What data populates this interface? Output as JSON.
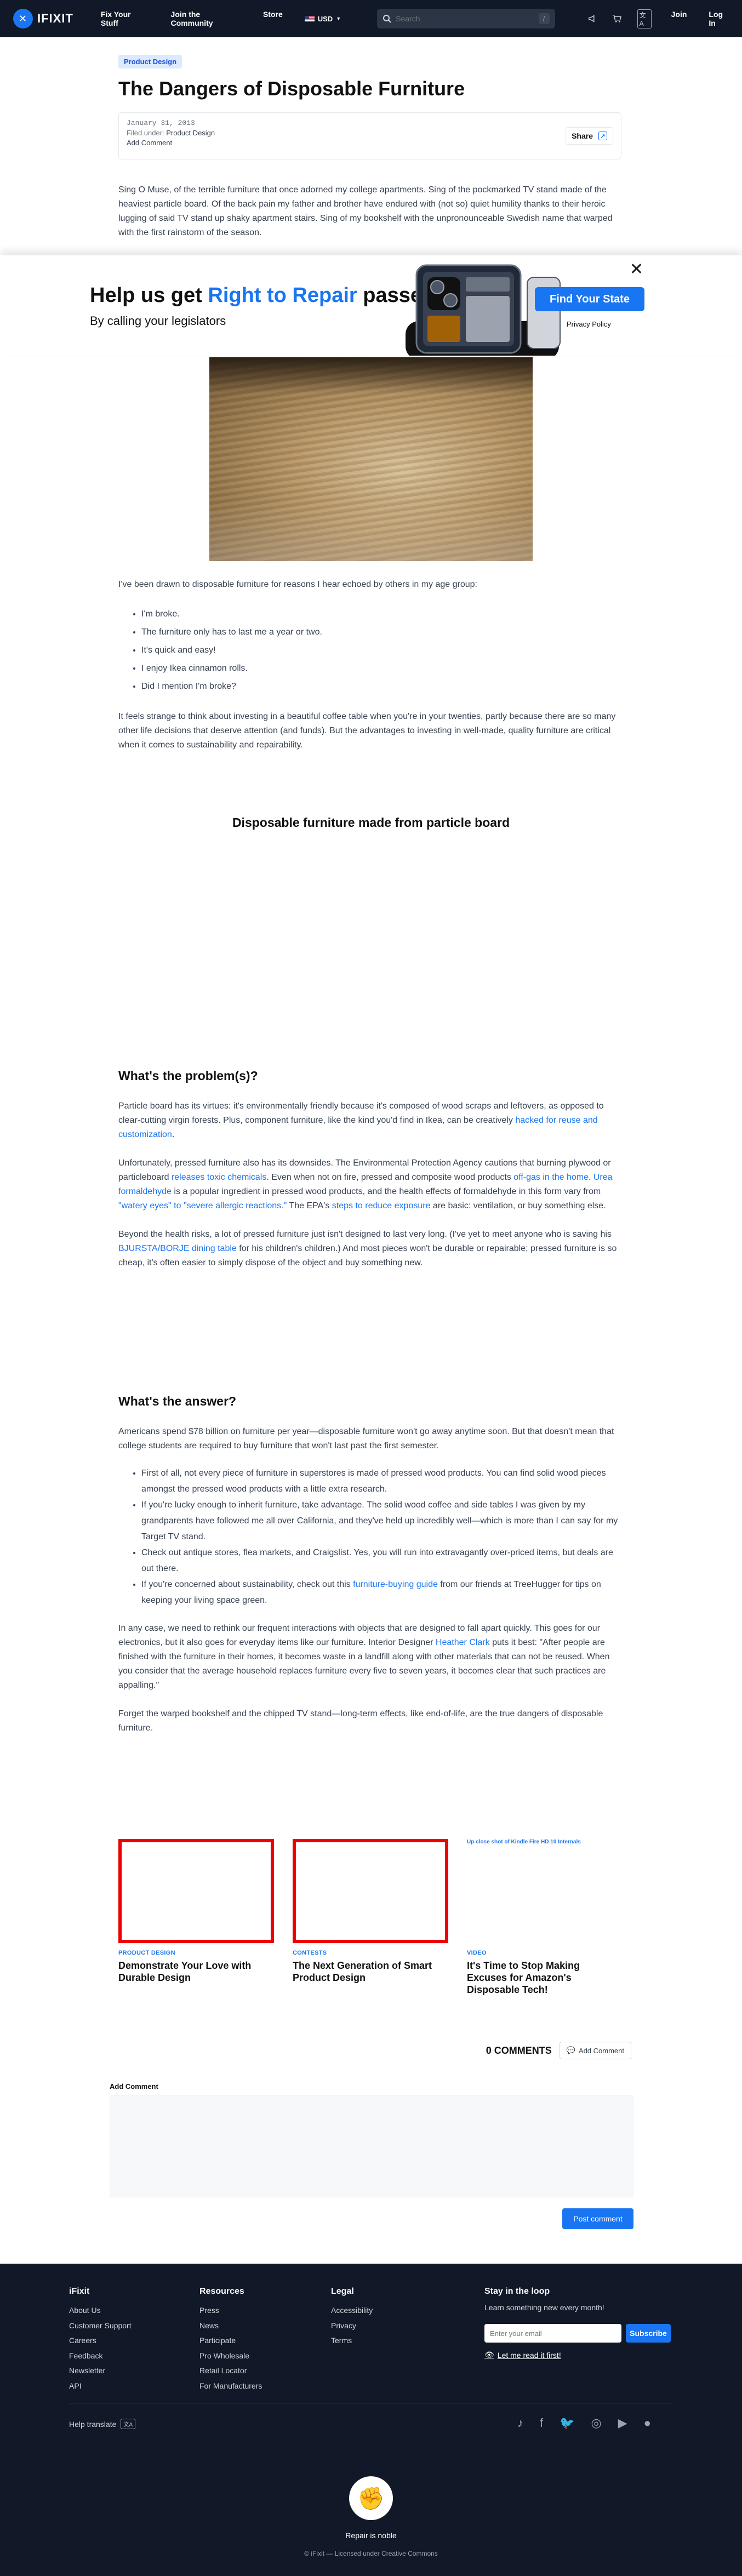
{
  "nav": {
    "logo": "IFIXIT",
    "links": [
      "Fix Your Stuff",
      "Join the Community",
      "Store"
    ],
    "locale": "USD",
    "search_placeholder": "Search",
    "search_shortcut": "/",
    "icon_names": [
      "megaphone-icon",
      "cart-icon",
      "language-icon"
    ],
    "language_icon_text": "文A",
    "join": "Join",
    "login": "Log In"
  },
  "article": {
    "category": "Product Design",
    "title": "The Dangers of Disposable Furniture",
    "date": "January 31, 2013",
    "filed_under_label": "Filed under: ",
    "filed_under": "Product Design",
    "add_comment": "Add Comment",
    "share": "Share",
    "intro": "Sing O Muse, of the terrible furniture that once adorned my college apartments. Sing of the pockmarked TV stand made of the heaviest particle board. Of the back pain my father and brother have endured with (not so) quiet humility thanks to their heroic lugging of said TV stand up shaky apartment stairs. Sing of my bookshelf with the unpronounceable Swedish name that warped with the first rainstorm of the season.",
    "reasons_intro": "I've been drawn to disposable furniture for reasons I hear echoed by others in my age group:",
    "reasons": [
      "I'm broke.",
      "The furniture only has to last me a year or two.",
      "It's quick and easy!",
      "I enjoy Ikea cinnamon rolls.",
      "Did I mention I'm broke?"
    ],
    "strange_para": "It feels strange to think about investing in a beautiful coffee table when you're in your twenties, partly because there are so many other life decisions that deserve attention (and funds). But the advantages to investing in well-made, quality furniture are critical when it comes to sustainability and repairability.",
    "video_title": "Disposable furniture made from particle board",
    "problem_heading": "What's the problem(s)?",
    "problem_p1_a": "Particle board has its virtues: it's environmentally friendly because it's composed of wood scraps and leftovers, as opposed to clear-cutting virgin forests. Plus, component furniture, like the kind you'd find in Ikea, can be creatively ",
    "problem_p1_link": "hacked for reuse and customization",
    "problem_p1_b": ".",
    "problem_p2_a": "Unfortunately, pressed furniture also has its downsides. The Environmental Protection Agency cautions that burning plywood or particleboard ",
    "problem_p2_link1": "releases toxic chemicals",
    "problem_p2_b": ". Even when not on fire, pressed and composite wood products ",
    "problem_p2_link2": "off-gas in the home",
    "problem_p2_c": ". ",
    "problem_p2_link3": "Urea formaldehyde",
    "problem_p2_d": " is a popular ingredient in pressed wood products, and the health effects of formaldehyde in this form vary from ",
    "problem_p2_link4": "\"watery eyes\" to \"severe allergic reactions.\"",
    "problem_p2_e": " The EPA's ",
    "problem_p2_link5": "steps to reduce exposure",
    "problem_p2_f": " are basic: ventilation, or buy something else.",
    "problem_p3_a": "Beyond the health risks, a lot of pressed furniture just isn't designed to last very long. (I've yet to meet anyone who is saving his ",
    "problem_p3_link": "BJURSTA/BORJE dining table",
    "problem_p3_b": " for his children's children.) And most pieces won't be durable or repairable; pressed furniture is so cheap, it's often easier to simply dispose of the object and buy something new.",
    "answer_heading": "What's the answer?",
    "answer_p1": "Americans spend $78 billion on furniture per year—disposable furniture won't go away anytime soon. But that doesn't mean that college students are required to buy furniture that won't last past the first semester.",
    "answer_list": [
      "First of all, not every piece of furniture in superstores is made of pressed wood products. You can find solid wood pieces amongst the pressed wood products with a little extra research.",
      "If you're lucky enough to inherit furniture, take advantage. The solid wood coffee and side tables I was given by my grandparents have followed me all over California, and they've held up incredibly well—which is more than I can say for my Target TV stand.",
      "Check out antique stores, flea markets, and Craigslist. Yes, you will run into extravagantly over-priced items, but deals are out there."
    ],
    "answer_list_last_a": "If you're concerned about sustainability, check out this ",
    "answer_list_last_link": "furniture-buying guide",
    "answer_list_last_b": " from our friends at TreeHugger for tips on keeping your living space green.",
    "answer_p2_a": "In any case, we need to rethink our frequent interactions with objects that are designed to fall apart quickly. This goes for our electronics, but it also goes for everyday items like our furniture. Interior Designer ",
    "answer_p2_link": "Heather Clark",
    "answer_p2_b": " puts it best: \"After people are finished with the furniture in their homes, it becomes waste in a landfill along with other materials that can not be reused. When you consider that the average household replaces furniture every five to seven years, it becomes clear that such practices are appalling.\"",
    "answer_p3": "Forget the warped bookshelf and the chipped TV stand—long-term effects, like end-of-life, are the true dangers of disposable furniture."
  },
  "banner": {
    "title_a": "Help us get ",
    "title_highlight": "Right to Repair",
    "title_b": " passed",
    "subtitle": "By calling your legislators",
    "cta": "Find Your State",
    "privacy": "Privacy Policy",
    "close": "✕"
  },
  "related": [
    {
      "category": "PRODUCT DESIGN",
      "title": "Demonstrate Your Love with Durable Design",
      "caption": ""
    },
    {
      "category": "CONTESTS",
      "title": "The Next Generation of Smart Product Design",
      "caption": ""
    },
    {
      "category": "VIDEO",
      "title": "It's Time to Stop Making Excuses for Amazon's Disposable Tech!",
      "caption": "Up close shot of Kindle Fire HD 10 Internals"
    }
  ],
  "comments": {
    "count": "0 COMMENTS",
    "add": "Add Comment",
    "label": "Add Comment",
    "post": "Post comment"
  },
  "footer": {
    "col1_title": "iFixit",
    "col1": [
      "About Us",
      "Customer Support",
      "Careers",
      "Feedback",
      "Newsletter",
      "API"
    ],
    "col2_title": "Resources",
    "col2": [
      "Press",
      "News",
      "Participate",
      "Pro Wholesale",
      "Retail Locator",
      "For Manufacturers"
    ],
    "col3_title": "Legal",
    "col3": [
      "Accessibility",
      "Privacy",
      "Terms"
    ],
    "news_title": "Stay in the loop",
    "news_sub": "Learn something new every month!",
    "email_placeholder": "Enter your email",
    "subscribe": "Subscribe",
    "learn_more": "Let me read it first!",
    "help_translate": "Help translate",
    "translate_icon_text": "文A",
    "social_icons": [
      "tiktok-icon",
      "facebook-icon",
      "twitter-icon",
      "instagram-icon",
      "youtube-icon",
      "discourse-icon"
    ],
    "motto": "Repair is noble",
    "license": "© iFixit — Licensed under Creative Commons"
  }
}
